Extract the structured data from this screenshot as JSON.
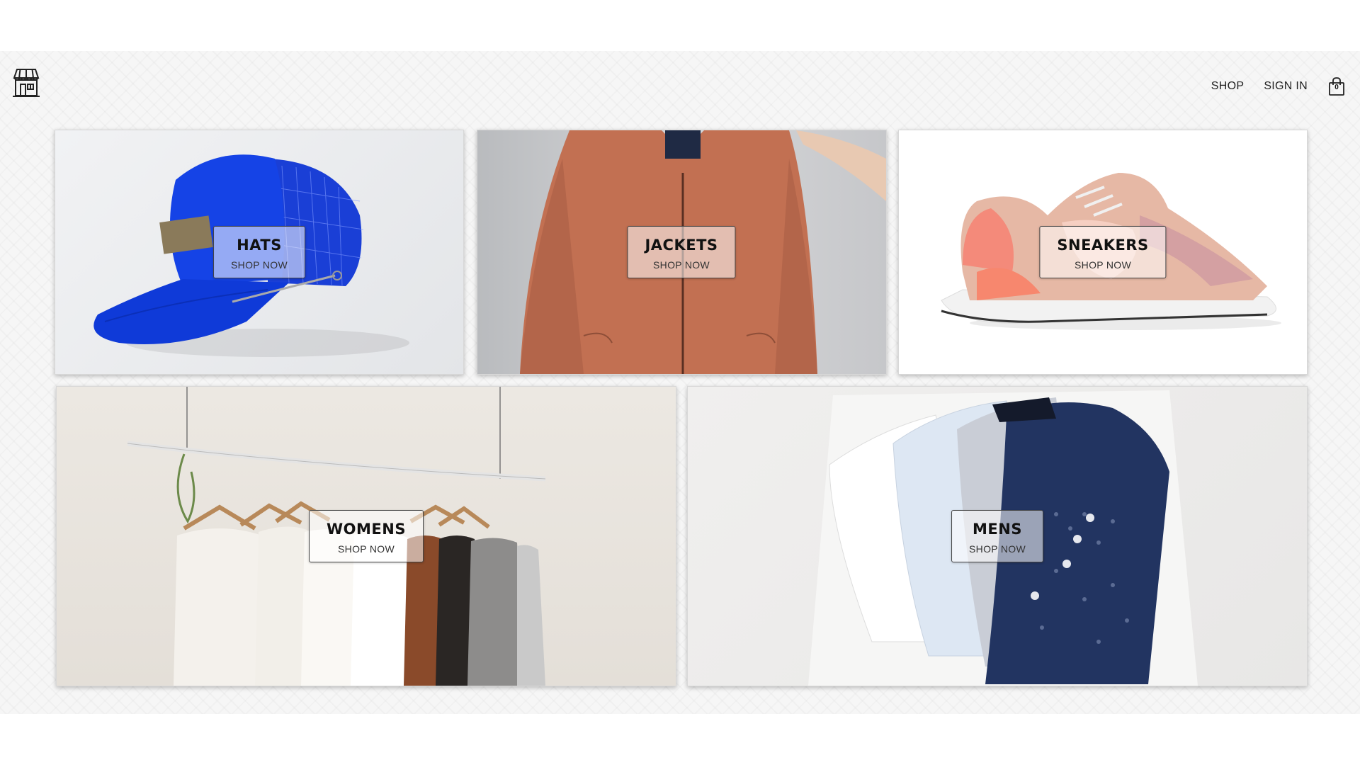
{
  "header": {
    "logo_icon": "storefront-icon",
    "nav": {
      "shop_label": "SHOP",
      "signin_label": "SIGN IN"
    },
    "cart": {
      "icon": "shopping-bag-icon",
      "count": "0"
    }
  },
  "categories": [
    {
      "title": "HATS",
      "cta": "SHOP NOW"
    },
    {
      "title": "JACKETS",
      "cta": "SHOP NOW"
    },
    {
      "title": "SNEAKERS",
      "cta": "SHOP NOW"
    },
    {
      "title": "WOMENS",
      "cta": "SHOP NOW"
    },
    {
      "title": "MENS",
      "cta": "SHOP NOW"
    }
  ],
  "colors": {
    "text": "#111111",
    "background": "#f6f6f6"
  }
}
